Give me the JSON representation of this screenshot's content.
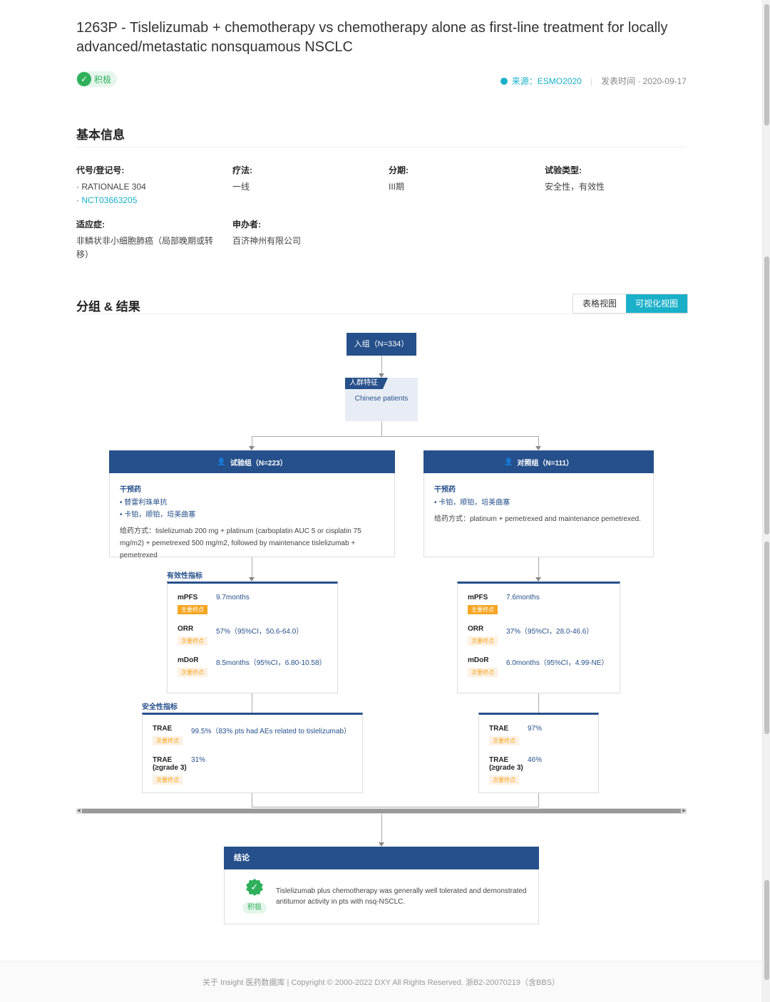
{
  "title": "1263P - Tislelizumab + chemotherapy vs chemotherapy alone as first-line treatment for locally advanced/metastatic nonsquamous NSCLC",
  "result_tag": "积极",
  "source_prefix": "来源：",
  "source_name": "ESMO2020",
  "publish_label": "发表时间 · 2020-09-17",
  "basic_info": {
    "heading": "基本信息",
    "code_label": "代号/登记号:",
    "code_1": "RATIONALE 304",
    "code_2": "NCT03663205",
    "therapy_label": "疗法:",
    "therapy": "一线",
    "phase_label": "分期:",
    "phase": "III期",
    "trial_type_label": "试验类型:",
    "trial_type": "安全性，有效性",
    "indication_label": "适应症:",
    "indication": "非鳞状非小细胞肺癌（局部晚期或转移）",
    "sponsor_label": "申办者:",
    "sponsor": "百济神州有限公司"
  },
  "results": {
    "heading": "分组 & 结果",
    "view_table": "表格视图",
    "view_visual": "可视化视图"
  },
  "flow": {
    "enroll": "入组（N=334）",
    "population_tag": "人群特征",
    "population": "Chinese patients",
    "exp_arm": {
      "title": "试验组（N=223）",
      "intervention_label": "干预药",
      "drug_1": "• 替雷利珠单抗",
      "drug_2": "• 卡铂，顺铂，培美曲塞",
      "admin": "给药方式：tislelizumab 200 mg + platinum (carboplatin AUC 5 or cisplatin 75 mg/m2) + pemetrexed 500 mg/m2, followed by maintenance tislelizumab + pemetrexed"
    },
    "ctrl_arm": {
      "title": "对照组（N=111）",
      "intervention_label": "干预药",
      "drug_1": "• 卡铂，顺铂，培美曲塞",
      "admin": "给药方式：platinum + pemetrexed and maintenance pemetrexed."
    },
    "efficacy_label": "有效性指标",
    "safety_label": "安全性指标",
    "primary": "主要终点",
    "secondary": "次要终点",
    "exp_efficacy": [
      {
        "name": "mPFS",
        "value": "9.7months",
        "kind": "primary"
      },
      {
        "name": "ORR",
        "value": "57%（95%CI，50.6-64.0）",
        "kind": "secondary"
      },
      {
        "name": "mDoR",
        "value": "8.5months（95%CI，6.80-10.58）",
        "kind": "secondary"
      }
    ],
    "ctrl_efficacy": [
      {
        "name": "mPFS",
        "value": "7.6months",
        "kind": "primary"
      },
      {
        "name": "ORR",
        "value": "37%（95%CI，28.0-46.6）",
        "kind": "secondary"
      },
      {
        "name": "mDoR",
        "value": "6.0months（95%CI，4.99-NE）",
        "kind": "secondary"
      }
    ],
    "exp_safety": [
      {
        "name": "TRAE",
        "value": "99.5%（83% pts had AEs related to tislelizumab）",
        "kind": "secondary"
      },
      {
        "name": "TRAE (≥grade 3)",
        "value": "31%",
        "kind": "secondary"
      }
    ],
    "ctrl_safety": [
      {
        "name": "TRAE",
        "value": "97%",
        "kind": "secondary"
      },
      {
        "name": "TRAE (≥grade 3)",
        "value": "46%",
        "kind": "secondary"
      }
    ]
  },
  "conclusion": {
    "heading": "结论",
    "tag": "积极",
    "text": "Tislelizumab plus chemotherapy was generally well tolerated and demonstrated antitumor activity in pts with nsq-NSCLC."
  },
  "footer": "关于 Insight 医药数据库  |  Copyright © 2000-2022 DXY All Rights Reserved. 浙B2-20070219（含BBS）",
  "colors": {
    "accent": "#1ab0c9",
    "navy": "#26508b",
    "positive": "#2eb05b",
    "primary_badge": "#f5a623"
  },
  "icons": {
    "check_circle": "check-circle-icon",
    "shield": "shield-check-icon",
    "user": "user-icon"
  }
}
